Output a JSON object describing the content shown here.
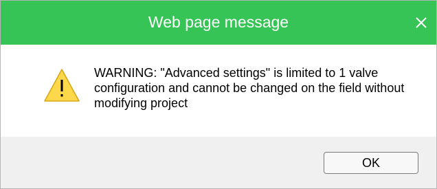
{
  "window": {
    "title": "Web page message",
    "close_icon": "close-icon",
    "title_bar_color": "#35c455"
  },
  "message": {
    "icon": "warning-icon",
    "text": "WARNING: \"Advanced settings\" is limited to 1 valve configuration and cannot be changed on the field without modifying project"
  },
  "buttons": {
    "ok_label": "OK"
  },
  "colors": {
    "warning_fill": "#fcd84a",
    "footer_background": "#f0f0f0"
  }
}
